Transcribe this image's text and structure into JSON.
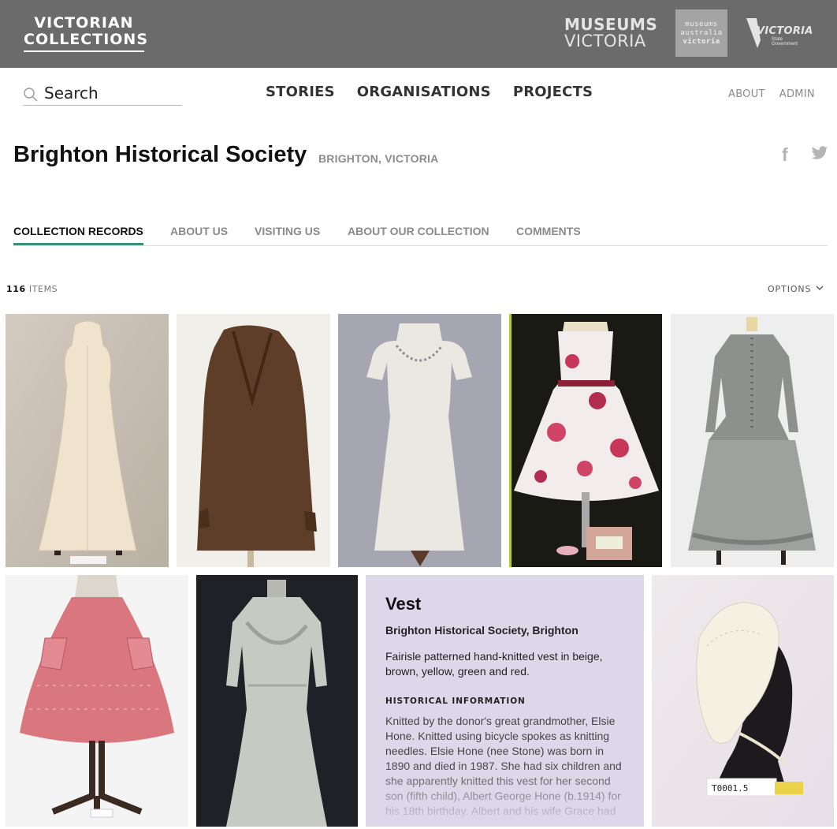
{
  "banner": {
    "logo_line1": "VICTORIAN",
    "logo_line2": "COLLECTIONS",
    "museums_line1": "MUSEUMS",
    "museums_line2": "VICTORIA",
    "ma_line1": "museums",
    "ma_line2": "australia",
    "ma_line3": "victoria",
    "vicgov_name": "VICTORIA",
    "vicgov_sub1": "State",
    "vicgov_sub2": "Government"
  },
  "search": {
    "placeholder": "Search"
  },
  "nav": {
    "stories": "STORIES",
    "organisations": "ORGANISATIONS",
    "projects": "PROJECTS",
    "about": "ABOUT",
    "admin": "ADMIN"
  },
  "org": {
    "name": "Brighton Historical Society",
    "location": "BRIGHTON, VICTORIA"
  },
  "social": {
    "facebook": "f"
  },
  "tabs": [
    "COLLECTION RECORDS",
    "ABOUT US",
    "VISITING US",
    "ABOUT OUR COLLECTION",
    "COMMENTS"
  ],
  "results": {
    "count": "116",
    "count_label": "ITEMS",
    "options_label": "OPTIONS"
  },
  "card": {
    "title": "Vest",
    "org": "Brighton Historical Society, Brighton",
    "description": "Fairisle patterned hand-knitted vest in beige, brown, yellow, green and red.",
    "historical_heading": "HISTORICAL INFORMATION",
    "historical_text": "Knitted by the donor's great grandmother, Elsie Hone. Knitted using bicycle spokes as knitting needles. Elsie Hone (nee Stone) was born in 1890 and died in 1987. She had six children and she apparently knitted this vest for her second son (fifth child), Albert George Hone (b.1914) for his 18th birthday. Albert and his wife Grace had"
  },
  "tile_labels": {
    "bonnet_tag": "T0001.5"
  },
  "colors": {
    "banner": "#6b6b6b",
    "tab_active": "#3a8f7d",
    "card_bg": "#dcd8ea"
  }
}
